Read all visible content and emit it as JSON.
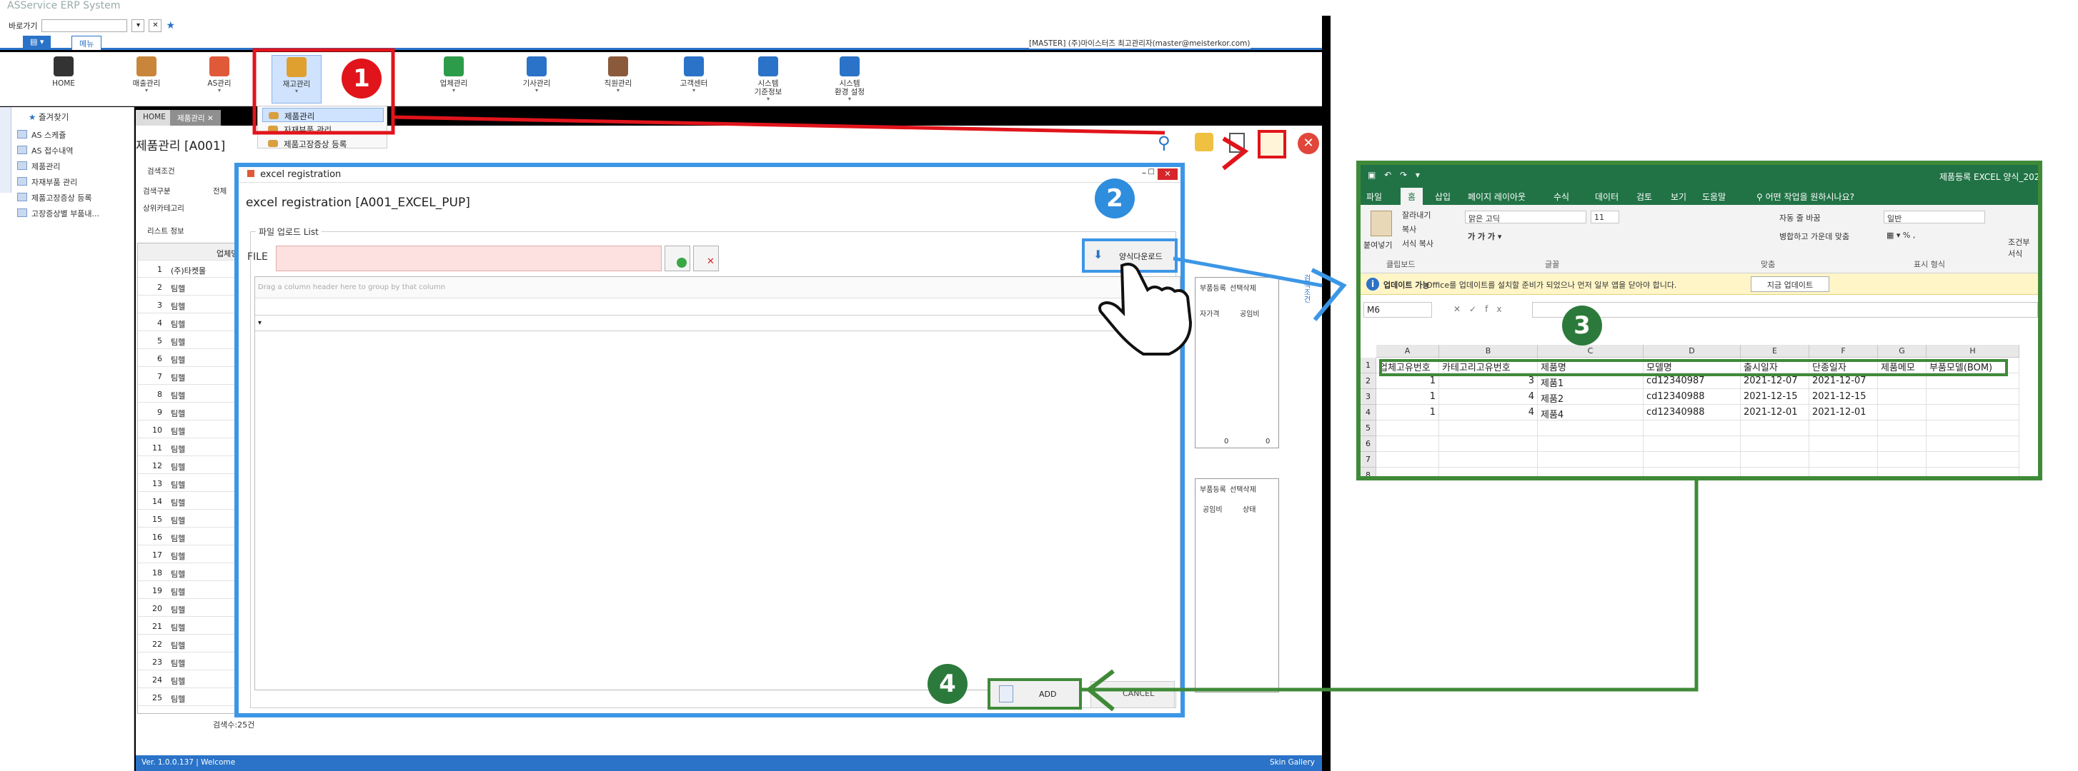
{
  "erp": {
    "window_title": "ASService ERP System",
    "address_label": "바로가기",
    "menu_tabs": [
      "메뉴"
    ],
    "user_info": "[MASTER] (주)마이스터즈 최고관리자(master@meisterkor.com)",
    "ribbon_items": [
      {
        "label": "HOME",
        "icon": "home-icon"
      },
      {
        "label": "매출관리",
        "icon": "sales-icon"
      },
      {
        "label": "AS관리",
        "icon": "as-icon"
      },
      {
        "label": "재고관리",
        "icon": "inventory-icon"
      },
      {
        "label": "업체관리",
        "icon": "company-icon"
      },
      {
        "label": "기사관리",
        "icon": "engineer-icon"
      },
      {
        "label": "직원관리",
        "icon": "staff-icon"
      },
      {
        "label": "고객센터",
        "icon": "customer-icon"
      },
      {
        "label": "시스템\n기준정보",
        "icon": "system-icon"
      },
      {
        "label": "시스템\n환경 설정",
        "icon": "settings-icon"
      }
    ],
    "inventory_menu": [
      {
        "label": "제품관리",
        "highlighted": true
      },
      {
        "label": "자재부품 관리",
        "highlighted": false
      },
      {
        "label": "제품고장증상 등록",
        "highlighted": false
      }
    ],
    "sidebar": {
      "title": "즐겨찾기",
      "items": [
        "AS 스케쥴",
        "AS 접수내역",
        "제품관리",
        "자재부품 관리",
        "제품고장증상 등록",
        "고장증상별 부품내..."
      ]
    },
    "doc_tabs": [
      "HOME",
      "제품관리"
    ],
    "page_title": "제품관리 [A001]",
    "search_label": "검색조건",
    "search_fields": [
      "검색구분",
      "상위카테고리"
    ],
    "search_value": "전체",
    "list_label": "리스트 정보",
    "list_header": "업체명",
    "list_rows": [
      "(주)타켓몰",
      "팀헬",
      "팀헬",
      "팀헬",
      "팀헬",
      "팀헬",
      "팀헬",
      "팀헬",
      "팀헬",
      "팀헬",
      "팀헬",
      "팀헬",
      "팀헬",
      "팀헬",
      "팀헬",
      "팀헬",
      "팀헬",
      "팀헬",
      "팀헬",
      "팀헬",
      "팀헬",
      "팀헬",
      "팀헬",
      "팀헬",
      "팀헬"
    ],
    "list_count": "검색수:25건",
    "right_panel_1": {
      "buttons": [
        "부품등록",
        "선택삭제"
      ],
      "cols": [
        "자가격",
        "공임비"
      ],
      "values": [
        "0",
        "0"
      ]
    },
    "right_panel_2": {
      "buttons": [
        "부품등록",
        "선택삭제"
      ],
      "cols": [
        "공임비",
        "상태"
      ]
    },
    "right_side_label": "검색조건",
    "status_left": "Ver. 1.0.0.137 | Welcome",
    "status_right": "Skin Gallery"
  },
  "popup": {
    "title": "excel registration",
    "heading": "excel registration [A001_EXCEL_PUP]",
    "group_label": "파일 업로드 List",
    "file_label": "FILE",
    "download_label": "양식다운로드",
    "grid_placeholder": "Drag a column header here to group by that column",
    "add_label": "ADD",
    "cancel_label": "CANCEL"
  },
  "excel": {
    "title": "제품등록 EXCEL 양식_202",
    "tabs": [
      "파일",
      "홈",
      "삽입",
      "페이지 레이아웃",
      "수식",
      "데이터",
      "검토",
      "보기",
      "도움말",
      "어떤 작업을 원하시나요?"
    ],
    "clipboard": {
      "paste": "붙여넣기",
      "cut": "잘라내기",
      "copy": "복사",
      "format": "서식 복사",
      "group": "클립보드"
    },
    "font": {
      "name": "맑은 고딕",
      "size": "11",
      "group": "글꼴"
    },
    "align": {
      "wrap": "자동 줄 바꿈",
      "merge": "병합하고 가운데 맞춤",
      "group": "맞춤"
    },
    "number": {
      "format": "일반",
      "group": "표시 형식"
    },
    "cond": "조건부 서식",
    "update_title": "업데이트 가능",
    "update_msg": "Office를 업데이트를 설치할 준비가 되었으나 먼저 일부 앱을 닫아야 합니다.",
    "update_btn": "지금 업데이트",
    "name_box": "M6",
    "columns": [
      "A",
      "B",
      "C",
      "D",
      "E",
      "F",
      "G",
      "H"
    ],
    "header_row": [
      "업체고유번호",
      "카테고리고유번호",
      "제품명",
      "모델명",
      "출시일자",
      "단종일자",
      "제품메모",
      "부품모델(BOM)"
    ],
    "rows": [
      [
        "1",
        "3",
        "제품1",
        "cd12340987",
        "2021-12-07",
        "2021-12-07",
        "",
        ""
      ],
      [
        "1",
        "4",
        "제품2",
        "cd12340988",
        "2021-12-15",
        "2021-12-15",
        "",
        ""
      ],
      [
        "1",
        "4",
        "제품4",
        "cd12340988",
        "2021-12-01",
        "2021-12-01",
        "",
        ""
      ]
    ],
    "row_numbers": [
      "1",
      "2",
      "3",
      "4",
      "5",
      "6",
      "7",
      "8"
    ]
  },
  "annotations": {
    "badges": [
      "1",
      "2",
      "3",
      "4"
    ],
    "colors": {
      "red": "#e1141b",
      "blue": "#3c96e6",
      "green": "#3f8a38"
    }
  }
}
